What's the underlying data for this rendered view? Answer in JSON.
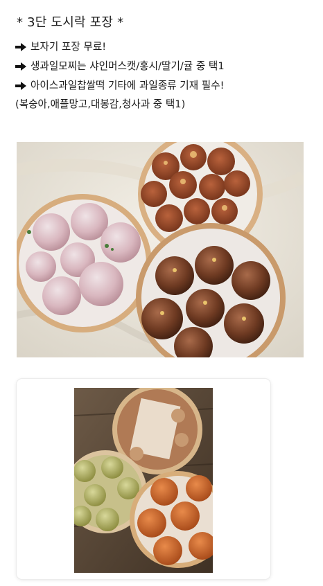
{
  "post": {
    "title": "* 3단 도시락 포장 *",
    "bullets": [
      {
        "icon": "right-arrow-icon",
        "text": "보자기 포장 무료!"
      },
      {
        "icon": "right-arrow-icon",
        "text": "생과일모찌는 샤인머스캣/홍시/딸기/귤 중 택1"
      },
      {
        "icon": "right-arrow-icon",
        "text": "아이스과일찹쌀떡 기타에 과일종류 기재 필수!"
      }
    ],
    "note": "(복숭아,애플망고,대봉감,청사과 중 택1)"
  },
  "colors": {
    "text": "#1b1b1b",
    "arrow": "#111111"
  },
  "images": {
    "photo1_icon": "dessert-boxes-photo",
    "photo2_icon": "dessert-boxes-photo"
  }
}
